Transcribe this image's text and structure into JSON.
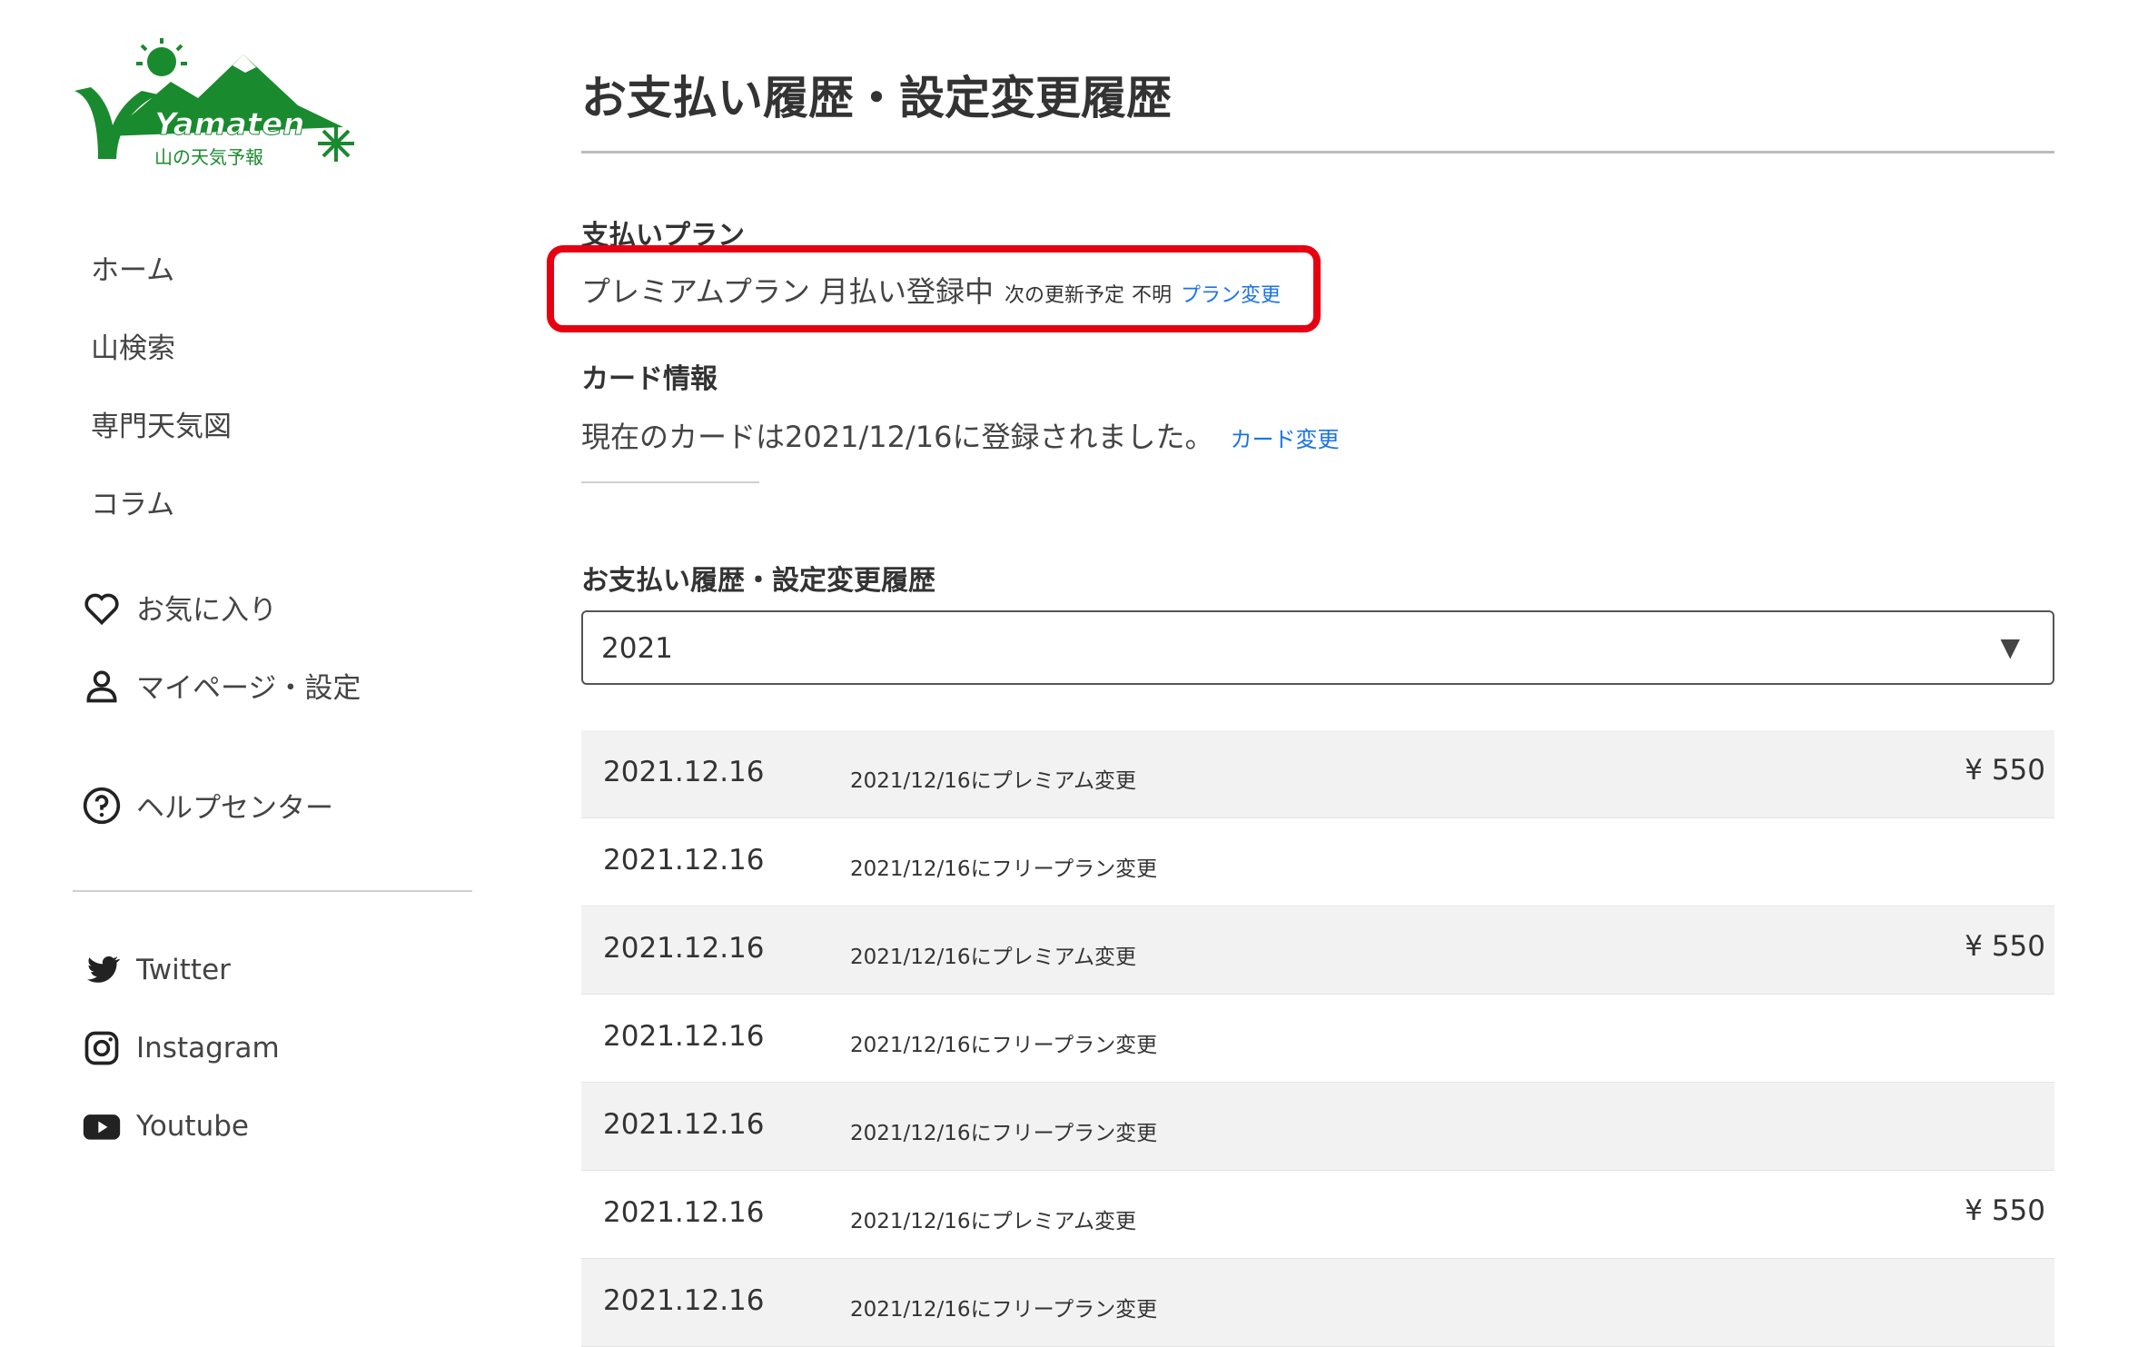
{
  "brand": {
    "name": "Yamaten",
    "tagline": "山の天気予報",
    "color": "#1a8a2e"
  },
  "nav": [
    "ホーム",
    "山検索",
    "専門天気図",
    "コラム"
  ],
  "user_links": [
    {
      "icon": "heart-icon",
      "label": "お気に入り"
    },
    {
      "icon": "person-icon",
      "label": "マイページ・設定"
    }
  ],
  "help": {
    "icon": "help-circle-icon",
    "label": "ヘルプセンター"
  },
  "social": [
    {
      "icon": "twitter-icon",
      "label": "Twitter"
    },
    {
      "icon": "instagram-icon",
      "label": "Instagram"
    },
    {
      "icon": "youtube-icon",
      "label": "Youtube"
    }
  ],
  "page_title": "お支払い履歴・設定変更履歴",
  "plan": {
    "heading": "支払いプラン",
    "status": "プレミアムプラン 月払い登録中",
    "renew_label": "次の更新予定",
    "renew_value": "不明",
    "change_link": "プラン変更"
  },
  "card": {
    "heading": "カード情報",
    "text": "現在のカードは2021/12/16に登録されました。",
    "change_link": "カード変更"
  },
  "history": {
    "heading": "お支払い履歴・設定変更履歴",
    "year": "2021",
    "rows": [
      {
        "date": "2021.12.16",
        "desc": "2021/12/16にプレミアム変更",
        "amount": "¥ 550"
      },
      {
        "date": "2021.12.16",
        "desc": "2021/12/16にフリープラン変更",
        "amount": ""
      },
      {
        "date": "2021.12.16",
        "desc": "2021/12/16にプレミアム変更",
        "amount": "¥ 550"
      },
      {
        "date": "2021.12.16",
        "desc": "2021/12/16にフリープラン変更",
        "amount": ""
      },
      {
        "date": "2021.12.16",
        "desc": "2021/12/16にフリープラン変更",
        "amount": ""
      },
      {
        "date": "2021.12.16",
        "desc": "2021/12/16にプレミアム変更",
        "amount": "¥ 550"
      },
      {
        "date": "2021.12.16",
        "desc": "2021/12/16にフリープラン変更",
        "amount": ""
      }
    ]
  },
  "colors": {
    "link": "#1a73e8",
    "highlight": "#e60012",
    "row_shade": "#f2f2f2"
  }
}
